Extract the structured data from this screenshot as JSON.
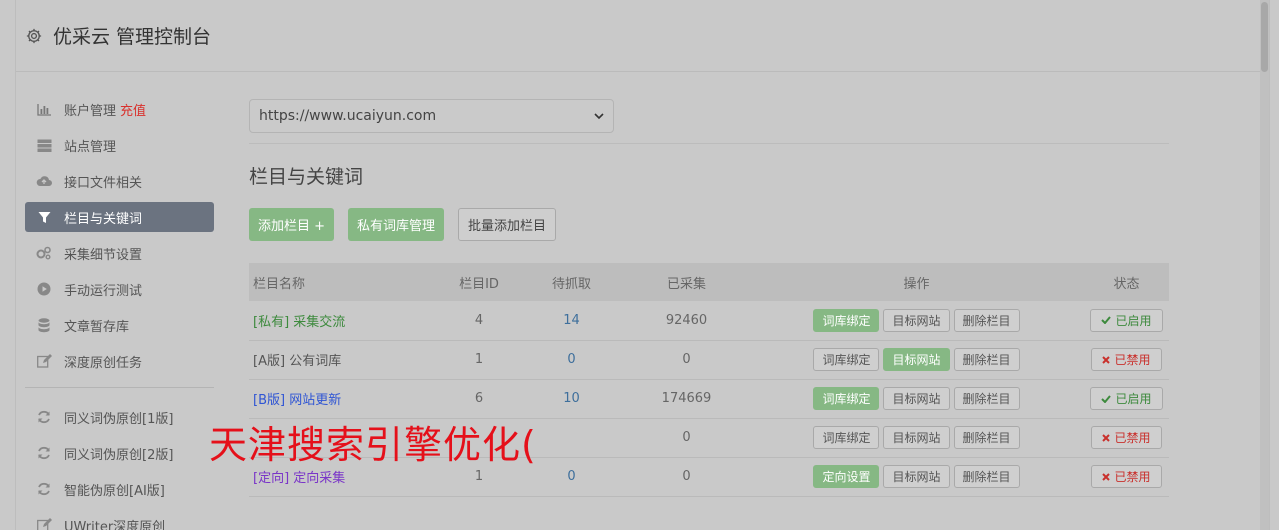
{
  "header": {
    "title": "优采云 管理控制台",
    "icon": "gear-icon"
  },
  "sidebar": {
    "items": [
      {
        "label": "账户管理",
        "extra": "充值",
        "icon": "bar-chart-icon"
      },
      {
        "label": "站点管理",
        "icon": "server-icon"
      },
      {
        "label": "接口文件相关",
        "icon": "cloud-upload-icon"
      },
      {
        "label": "栏目与关键词",
        "icon": "filter-icon",
        "active": true
      },
      {
        "label": "采集细节设置",
        "icon": "gears-icon"
      },
      {
        "label": "手动运行测试",
        "icon": "play-circle-icon"
      },
      {
        "label": "文章暂存库",
        "icon": "database-icon"
      },
      {
        "label": "深度原创任务",
        "icon": "edit-icon"
      }
    ],
    "items2": [
      {
        "label": "同义词伪原创[1版]",
        "icon": "refresh-icon"
      },
      {
        "label": "同义词伪原创[2版]",
        "icon": "refresh-icon"
      },
      {
        "label": "智能伪原创[AI版]",
        "icon": "refresh-icon"
      },
      {
        "label": "UWriter深度原创",
        "icon": "edit-icon"
      }
    ]
  },
  "main": {
    "site_select": {
      "value": "https://www.ucaiyun.com"
    },
    "section_title": "栏目与关键词",
    "buttons": {
      "add": "添加栏目 +",
      "private": "私有词库管理",
      "batch": "批量添加栏目"
    },
    "table": {
      "headers": [
        "栏目名称",
        "栏目ID",
        "待抓取",
        "已采集",
        "操作",
        "状态"
      ],
      "rows": [
        {
          "tag": "[私有]",
          "name": "采集交流",
          "tag_color": "#3d8a3d",
          "id": "4",
          "pending": "14",
          "collected": "92460",
          "op1": "词库绑定",
          "op1_green": true,
          "op2": "目标网站",
          "op2_green": false,
          "op3": "删除栏目",
          "status": "已启用",
          "status_on": true
        },
        {
          "tag": "[A版]",
          "name": "公有词库",
          "tag_color": "#555555",
          "id": "1",
          "pending": "0",
          "collected": "0",
          "op1": "词库绑定",
          "op1_green": false,
          "op2": "目标网站",
          "op2_green": true,
          "op3": "删除栏目",
          "status": "已禁用",
          "status_on": false
        },
        {
          "tag": "[B版]",
          "name": "网站更新",
          "tag_color": "#2f55d4",
          "id": "6",
          "pending": "10",
          "collected": "174669",
          "op1": "词库绑定",
          "op1_green": true,
          "op2": "目标网站",
          "op2_green": false,
          "op3": "删除栏目",
          "status": "已启用",
          "status_on": true
        },
        {
          "tag": "",
          "name": "",
          "tag_color": "#555555",
          "id": "",
          "pending": "",
          "collected": "0",
          "op1": "词库绑定",
          "op1_green": false,
          "op2": "目标网站",
          "op2_green": false,
          "op3": "删除栏目",
          "status": "已禁用",
          "status_on": false
        },
        {
          "tag": "[定向]",
          "name": "定向采集",
          "tag_color": "#7a35c8",
          "id": "1",
          "pending": "0",
          "collected": "0",
          "op1": "定向设置",
          "op1_green": true,
          "op2": "目标网站",
          "op2_green": false,
          "op3": "删除栏目",
          "status": "已禁用",
          "status_on": false
        }
      ]
    }
  },
  "watermark": "天津搜索引擎优化("
}
